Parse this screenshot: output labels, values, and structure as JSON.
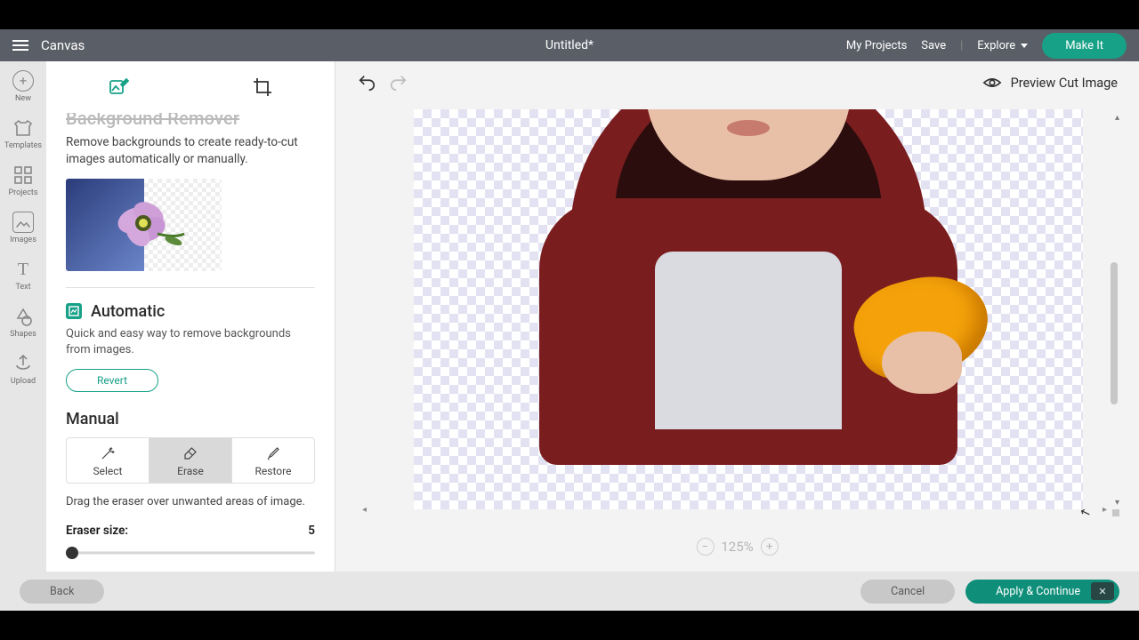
{
  "topbar": {
    "brand": "Canvas",
    "title": "Untitled*",
    "my_projects": "My Projects",
    "save": "Save",
    "explore": "Explore",
    "make_it": "Make It"
  },
  "rail": {
    "new": "New",
    "templates": "Templates",
    "projects": "Projects",
    "images": "Images",
    "text": "Text",
    "shapes": "Shapes",
    "upload": "Upload"
  },
  "panel": {
    "title": "Background Remover",
    "desc": "Remove backgrounds to create ready-to-cut images automatically or manually.",
    "automatic": {
      "label": "Automatic",
      "desc": "Quick and easy way to remove backgrounds from images.",
      "revert": "Revert"
    },
    "manual": {
      "label": "Manual",
      "select": "Select",
      "erase": "Erase",
      "restore": "Restore",
      "desc": "Drag the eraser over unwanted areas of image.",
      "eraser_label": "Eraser size:",
      "eraser_value": "5"
    }
  },
  "canvas": {
    "preview_label": "Preview Cut Image",
    "zoom": "125%"
  },
  "bottom": {
    "back": "Back",
    "cancel": "Cancel",
    "apply": "Apply & Continue"
  }
}
